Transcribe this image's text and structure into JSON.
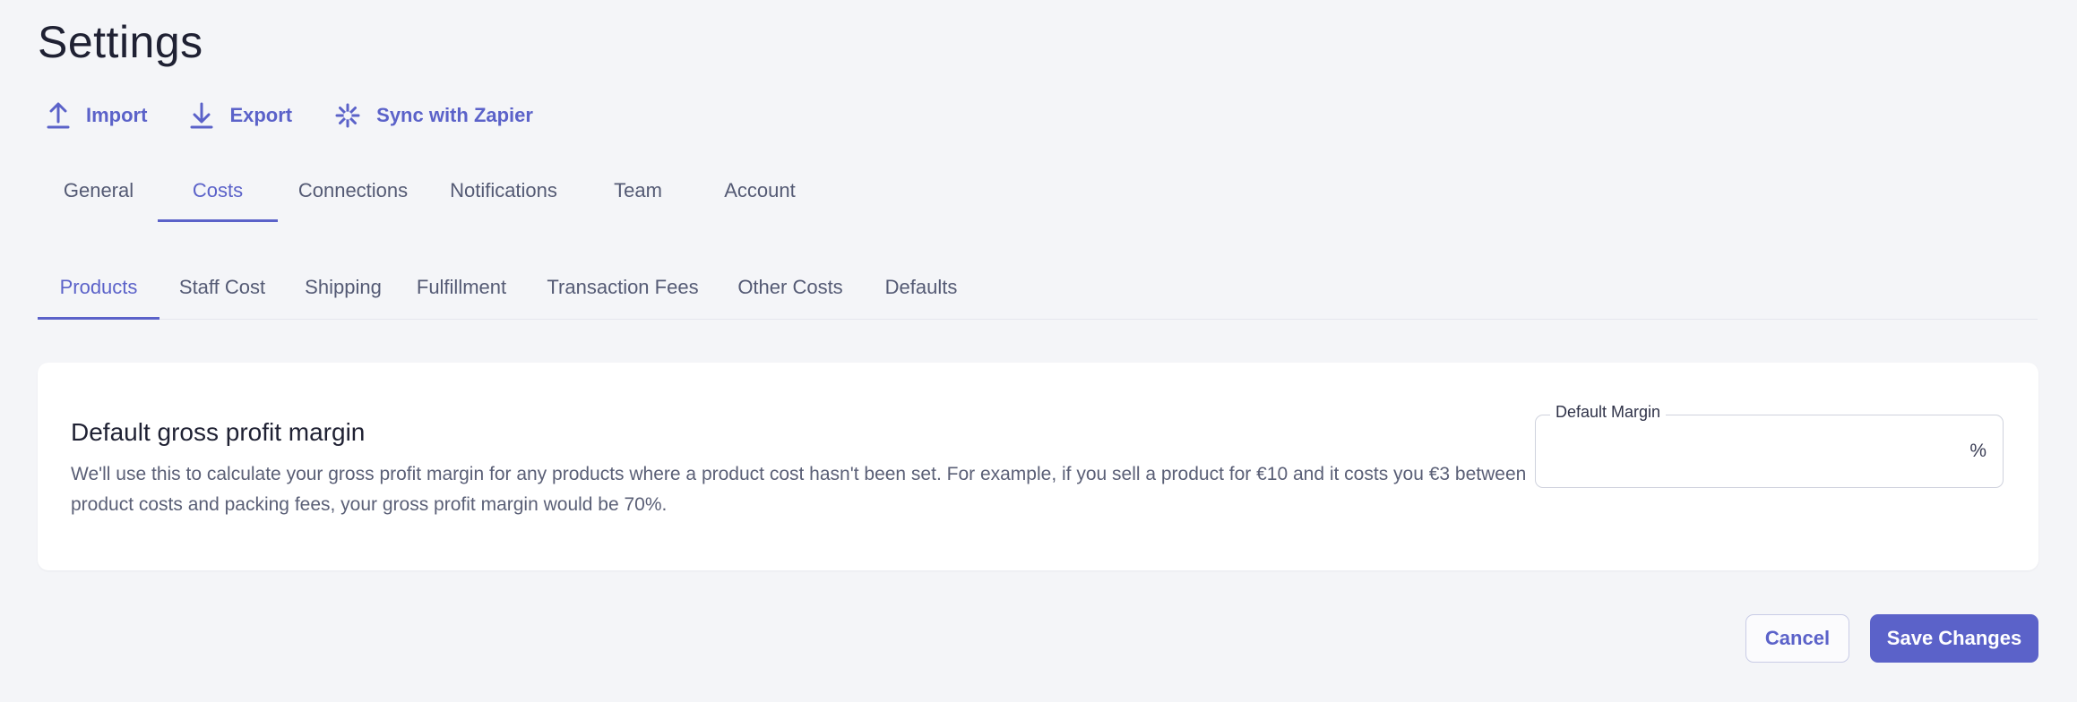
{
  "page": {
    "title": "Settings"
  },
  "actions": {
    "import_label": "Import",
    "export_label": "Export",
    "zapier_label": "Sync with Zapier"
  },
  "tabs": [
    {
      "label": "General",
      "active": false
    },
    {
      "label": "Costs",
      "active": true
    },
    {
      "label": "Connections",
      "active": false
    },
    {
      "label": "Notifications",
      "active": false
    },
    {
      "label": "Team",
      "active": false
    },
    {
      "label": "Account",
      "active": false
    }
  ],
  "subtabs": [
    {
      "label": "Products",
      "active": true
    },
    {
      "label": "Staff Cost",
      "active": false
    },
    {
      "label": "Shipping",
      "active": false
    },
    {
      "label": "Fulfillment",
      "active": false
    },
    {
      "label": "Transaction Fees",
      "active": false
    },
    {
      "label": "Other Costs",
      "active": false
    },
    {
      "label": "Defaults",
      "active": false
    }
  ],
  "margin_card": {
    "title": "Default gross profit margin",
    "description": "We'll use this to calculate your gross profit margin for any products where a product cost hasn't been set. For example, if you sell a product for €10 and it costs you €3 between product costs and packing fees, your gross profit margin would be 70%.",
    "field_label": "Default Margin",
    "field_value": "",
    "field_suffix": "%"
  },
  "footer": {
    "cancel_label": "Cancel",
    "save_label": "Save Changes"
  },
  "colors": {
    "accent": "#5b62c9",
    "background": "#f4f5f8",
    "text": "#545a74"
  },
  "icons": {
    "import": "upload-arrow-icon",
    "export": "download-arrow-icon",
    "zapier": "zapier-asterisk-icon"
  }
}
